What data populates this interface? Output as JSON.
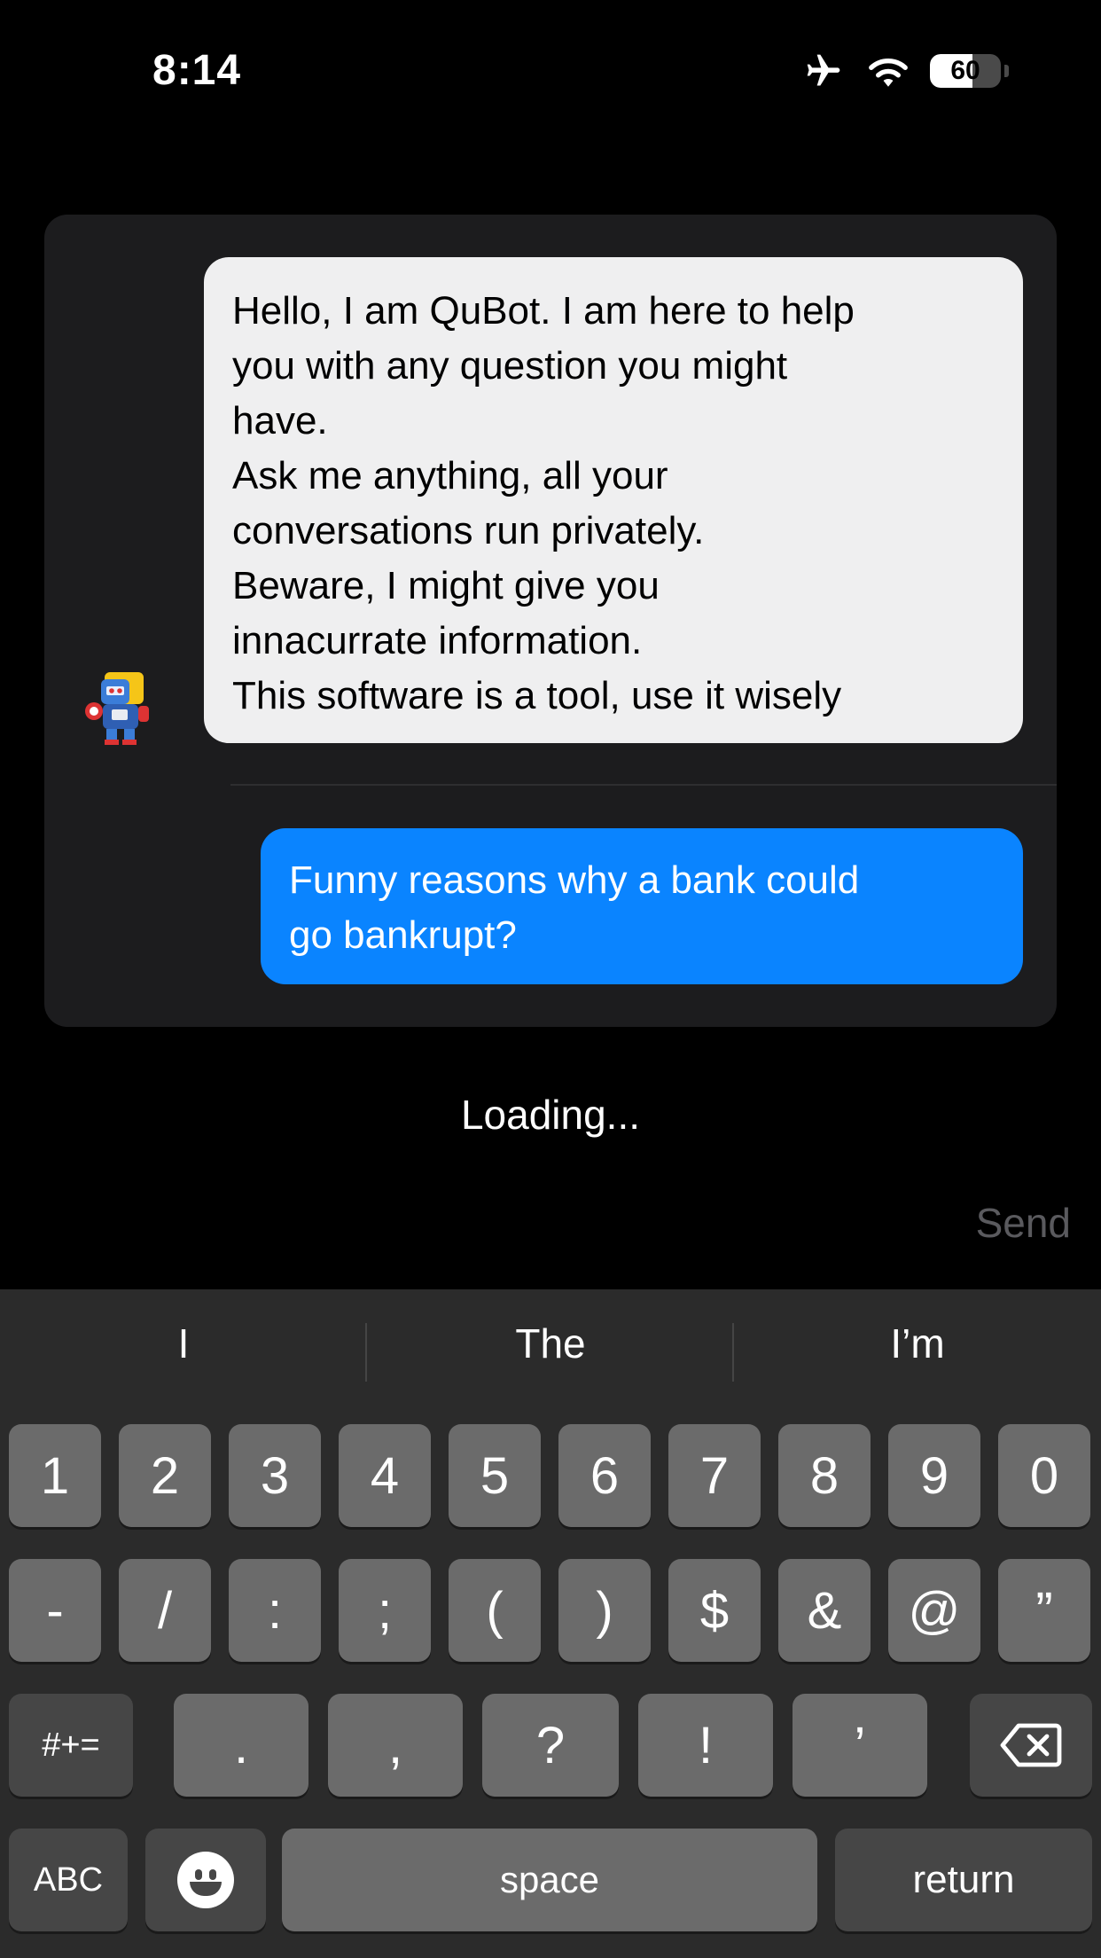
{
  "status_bar": {
    "time": "8:14",
    "battery_level": "60",
    "battery_fraction": 0.6,
    "icons": [
      "airplane-icon",
      "wifi-icon",
      "battery-icon"
    ]
  },
  "chat": {
    "avatar_icon": "robot-avatar-icon",
    "bot_message_lines": [
      "Hello, I am QuBot. I am here to help",
      "you with any question you might",
      "have.",
      "Ask me anything, all your",
      "conversations run privately.",
      "Beware, I might give you",
      "innacurrate information.",
      "This software is a tool, use it wisely"
    ],
    "user_message_lines": [
      "Funny reasons why a bank could",
      "go bankrupt?"
    ]
  },
  "loading_text": "Loading...",
  "send_label": "Send",
  "colors": {
    "background": "#000000",
    "panel": "#1c1c1e",
    "bot_bubble": "#efeff0",
    "user_bubble": "#0a84ff",
    "keyboard": "#2b2b2b",
    "key": "#6b6b6b",
    "key_dark": "#464646"
  },
  "keyboard": {
    "suggestions": [
      "I",
      "The",
      "I’m"
    ],
    "row1": [
      "1",
      "2",
      "3",
      "4",
      "5",
      "6",
      "7",
      "8",
      "9",
      "0"
    ],
    "row2": [
      "-",
      "/",
      ":",
      ";",
      "(",
      ")",
      "$",
      "&",
      "@",
      "”"
    ],
    "row3_mode": "#+=",
    "row3": [
      ".",
      ",",
      "?",
      "!",
      "’"
    ],
    "abc_label": "ABC",
    "space_label": "space",
    "return_label": "return",
    "delete_icon": "backspace-icon",
    "emoji_icon": "emoji-icon"
  }
}
